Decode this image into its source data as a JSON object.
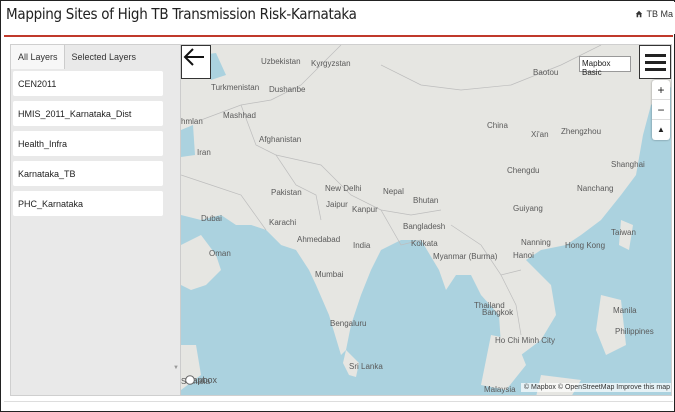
{
  "header": {
    "title": "Mapping Sites of High TB Transmission Risk-Karnataka",
    "right_text": "TB Ma"
  },
  "tabs": [
    {
      "label": "All Layers"
    },
    {
      "label": "Selected Layers"
    }
  ],
  "layers": [
    {
      "label": "CEN2011"
    },
    {
      "label": "HMIS_2011_Karnataka_Dist"
    },
    {
      "label": "Health_Infra"
    },
    {
      "label": "Karnataka_TB"
    },
    {
      "label": "PHC_Karnataka"
    }
  ],
  "map": {
    "basemap_select": "Mapbox Basic",
    "zoom_in": "+",
    "zoom_out": "−",
    "compass": "▲",
    "logo": "mapbox",
    "attribution": "© Mapbox © OpenStreetMap Improve this map",
    "labels": {
      "uzbekistan": "Uzbekistan",
      "kyrgyzstan": "Kyrgyzstan",
      "baotou": "Baotou",
      "turkmenistan": "Turkmenistan",
      "dushanbe": "Dushanbe",
      "hmlan": "hmlan",
      "mashhad": "Mashhad",
      "afghanistan": "Afghanistan",
      "china": "China",
      "xian": "Xi'an",
      "zhengzhou": "Zhengzhou",
      "iran": "Iran",
      "chengdu": "Chengdu",
      "shanghai": "Shanghai",
      "newdelhi": "New Delhi",
      "nepal": "Nepal",
      "pakistan": "Pakistan",
      "nanchang": "Nanchang",
      "jaipur": "Jaipur",
      "kanpur": "Kanpur",
      "bhutan": "Bhutan",
      "dubai": "Dubai",
      "karachi": "Karachi",
      "guiyang": "Guiyang",
      "taiwan": "Taiwan",
      "bangladesh": "Bangladesh",
      "ahmedabad": "Ahmedabad",
      "india": "India",
      "kolkata": "Kolkata",
      "nanning": "Nanning",
      "hongkong": "Hong Kong",
      "oman": "Oman",
      "myanmar": "Myanmar (Burma)",
      "hanoi": "Hanoi",
      "mumbai": "Mumbai",
      "thailand": "Thailand",
      "manila": "Manila",
      "bangkok": "Bangkok",
      "philippines": "Philippines",
      "bengaluru": "Bengaluru",
      "hcmc": "Ho Chi Minh City",
      "srilanka": "Sri Lanka",
      "somalia": "Somalia",
      "malaysia": "Malaysia"
    }
  }
}
